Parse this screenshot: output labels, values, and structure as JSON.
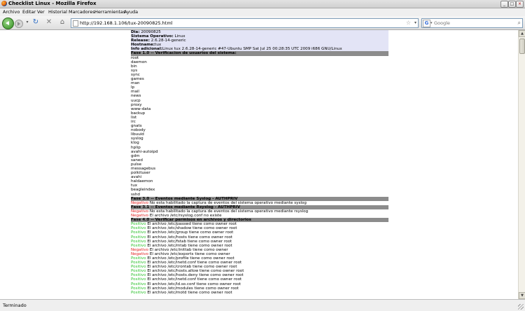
{
  "window": {
    "title": "Checklist Linux - Mozilla Firefox"
  },
  "menu": [
    "Archivo",
    "Editar",
    "Ver",
    "Historial",
    "Marcadores",
    "Herramientas",
    "Ayuda"
  ],
  "nav": {
    "url": "http://192.168.1.106/tux-20090825.html",
    "search_placeholder": "Google"
  },
  "info": {
    "dia_label": "Dia:",
    "dia_value": "20090825",
    "so_label": "Sistema Operativo:",
    "so_value": "Linux",
    "release_label": "Release:",
    "release_value": "2.6.28-14-generic",
    "hostname_label": "Hostname:",
    "hostname_value": "tux",
    "adicional_label": "Info adicional:",
    "adicional_value": "Linux tux 2.6.28-14-generic #47-Ubuntu SMP Sat Jul 25 00:28:35 UTC 2009 i686 GNU/Linux"
  },
  "fase1": {
    "header": "Fase 1.0 -- Verificacion de usuarios del sistema:",
    "users": [
      "root",
      "daemon",
      "bin",
      "sys",
      "sync",
      "games",
      "man",
      "lp",
      "mail",
      "news",
      "uucp",
      "proxy",
      "www-data",
      "backup",
      "list",
      "irc",
      "gnats",
      "nobody",
      "libuuid",
      "syslog",
      "klog",
      "hplip",
      "avahi-autoipd",
      "gdm",
      "saned",
      "pulse",
      "messagebus",
      "polkituser",
      "avahi",
      "haldaemon",
      "tux",
      "beagleindex",
      "sshd"
    ]
  },
  "fase3": {
    "header": "Fase 3.0 -- Eventos mediante Syslog - AUTHPRIV",
    "items": [
      {
        "status": "Negativo",
        "text": "No esta habilitado la captura de eventos del sistema operativo mediante syslog"
      }
    ]
  },
  "fase31": {
    "header": "Fase 3.1 -- Eventos mediante Rsyslog - AUTHPRIV",
    "items": [
      {
        "status": "Negativo",
        "text": "No esta habilitado la captura de eventos del sistema operativo mediante rsyslog"
      },
      {
        "status": "Negativo",
        "text": "El archivo /etc/rsyslog.conf no existe"
      }
    ]
  },
  "fase4": {
    "header": "Fase 4.0 -- Verificar permisos en archivos y directorios",
    "items": [
      {
        "status": "Positivo",
        "text": "El archivo /etc/passwd tiene como owner root"
      },
      {
        "status": "Positivo",
        "text": "El archivo /etc/shadow tiene como owner root"
      },
      {
        "status": "Positivo",
        "text": "El archivo /etc/group tiene como owner root"
      },
      {
        "status": "Positivo",
        "text": "El archivo /etc/hosts tiene como owner root"
      },
      {
        "status": "Positivo",
        "text": "El archivo /etc/fstab tiene como owner root"
      },
      {
        "status": "Positivo",
        "text": "El archivo /etc/mtab tiene como owner root"
      },
      {
        "status": "Negativo",
        "text": "El archivo /etc/inittab tiene como owner"
      },
      {
        "status": "Negativo",
        "text": "El archivo /etc/exports tiene como owner"
      },
      {
        "status": "Positivo",
        "text": "El archivo /etc/profile tiene como owner root"
      },
      {
        "status": "Positivo",
        "text": "El archivo /etc/inetd.conf tiene como owner root"
      },
      {
        "status": "Positivo",
        "text": "El archivo /etc/crontab tiene como owner root"
      },
      {
        "status": "Positivo",
        "text": "El archivo /etc/hosts.allow tiene como owner root"
      },
      {
        "status": "Positivo",
        "text": "El archivo /etc/hosts.deny tiene como owner root"
      },
      {
        "status": "Positivo",
        "text": "El archivo /etc/inetd.conf tiene como owner root"
      },
      {
        "status": "Positivo",
        "text": "El archivo /etc/ld.so.conf tiene como owner root"
      },
      {
        "status": "Positivo",
        "text": "El archivo /etc/modules tiene como owner root"
      },
      {
        "status": "Positivo",
        "text": "El archivo /etc/motd tiene como owner root"
      }
    ]
  },
  "status_bar": "Terminado",
  "colors": {
    "positivo": "#2ec12e",
    "negativo": "#e02020",
    "phase_bg": "#8c8c8c",
    "info_bg": "#e3e4f6"
  }
}
